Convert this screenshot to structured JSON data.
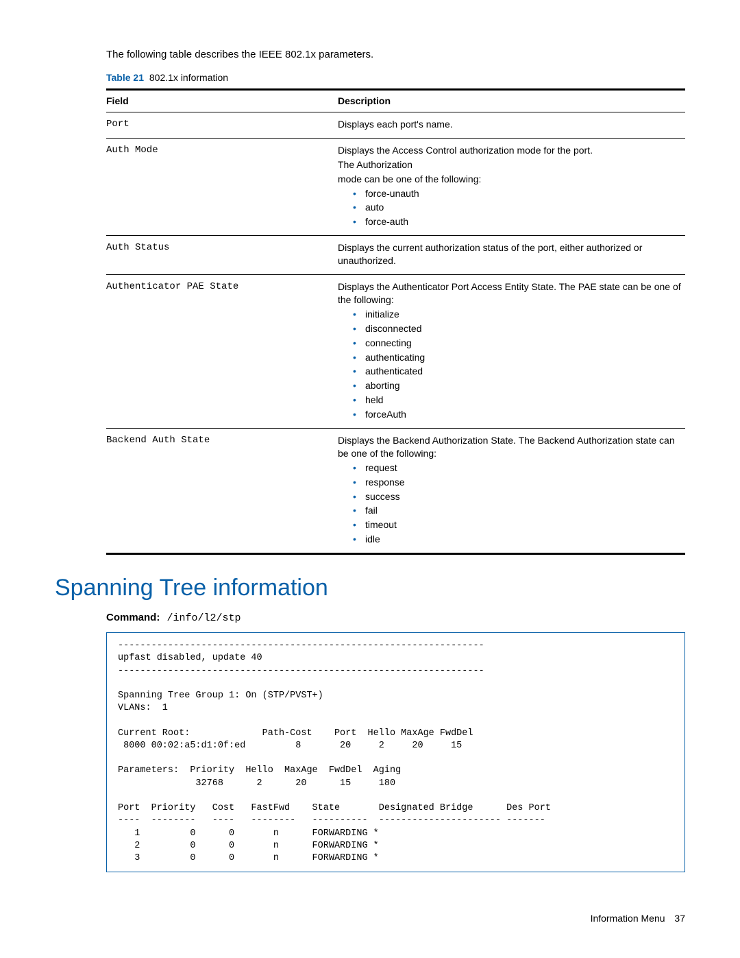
{
  "intro_text": "The following table describes the IEEE 802.1x parameters.",
  "table_caption": {
    "label": "Table 21",
    "title": "802.1x information"
  },
  "table_headers": {
    "field": "Field",
    "description": "Description"
  },
  "rows": [
    {
      "field": "Port",
      "desc_lines": [
        "Displays each port's name."
      ],
      "bullets": []
    },
    {
      "field": "Auth Mode",
      "desc_lines": [
        "Displays the Access Control authorization mode for the port.",
        "The Authorization",
        "mode can be one of the following:"
      ],
      "bullets": [
        "force-unauth",
        "auto",
        "force-auth"
      ]
    },
    {
      "field": "Auth Status",
      "desc_lines": [
        "Displays the current authorization status of the port, either authorized or unauthorized."
      ],
      "bullets": []
    },
    {
      "field": "Authenticator PAE State",
      "desc_lines": [
        "Displays the Authenticator Port Access Entity State. The PAE state can be one of the following:"
      ],
      "bullets": [
        "initialize",
        "disconnected",
        "connecting",
        "authenticating",
        "authenticated",
        "aborting",
        "held",
        "forceAuth"
      ]
    },
    {
      "field": "Backend Auth State",
      "desc_lines": [
        "Displays the Backend Authorization State. The Backend Authorization state can be one of the following:"
      ],
      "bullets": [
        "request",
        "response",
        "success",
        "fail",
        "timeout",
        "idle"
      ]
    }
  ],
  "section_heading": "Spanning Tree information",
  "command": {
    "label": "Command:",
    "path": "/info/l2/stp"
  },
  "terminal_output": "------------------------------------------------------------------\nupfast disabled, update 40\n------------------------------------------------------------------\n\nSpanning Tree Group 1: On (STP/PVST+)\nVLANs:  1\n\nCurrent Root:             Path-Cost    Port  Hello MaxAge FwdDel\n 8000 00:02:a5:d1:0f:ed         8       20     2     20     15\n\nParameters:  Priority  Hello  MaxAge  FwdDel  Aging\n              32768      2      20      15     180\n\nPort  Priority   Cost   FastFwd    State       Designated Bridge      Des Port\n----  --------   ----   --------   ----------  ---------------------- -------\n   1         0      0       n      FORWARDING *\n   2         0      0       n      FORWARDING *\n   3         0      0       n      FORWARDING *",
  "footer": {
    "section": "Information Menu",
    "page": "37"
  }
}
